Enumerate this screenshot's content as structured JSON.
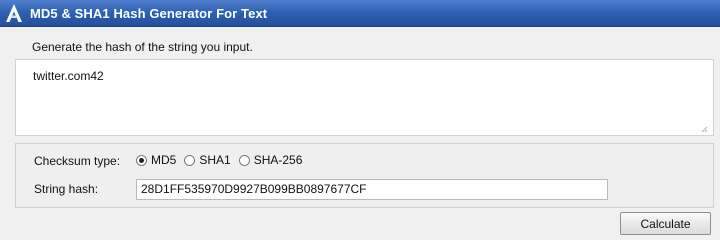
{
  "app": {
    "title": "MD5 & SHA1 Hash Generator For Text"
  },
  "input_section": {
    "instruction": "Generate the hash of the string you input.",
    "value": "twitter.com42"
  },
  "options": {
    "checksum_label": "Checksum type:",
    "checksum_types": [
      {
        "label": "MD5",
        "selected": true
      },
      {
        "label": "SHA1",
        "selected": false
      },
      {
        "label": "SHA-256",
        "selected": false
      }
    ],
    "hash_label": "String hash:",
    "hash_value": "28D1FF535970D9927B099BB0897677CF"
  },
  "actions": {
    "calculate_label": "Calculate"
  },
  "colors": {
    "titlebar": "#2d5fb2",
    "titlebar_text": "#ffffff",
    "background": "#f0f0f0"
  }
}
